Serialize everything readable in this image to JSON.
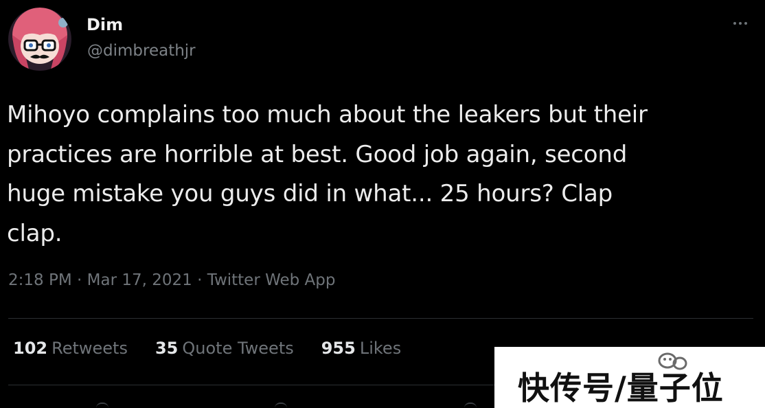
{
  "tweet": {
    "author": {
      "name": "Dim",
      "handle": "@dimbreathjr"
    },
    "text_lines": [
      "Mihoyo complains too much about the leakers but their",
      "practices are horrible at best. Good job again, second",
      "huge mistake you guys did in what... 25 hours? Clap",
      "clap."
    ],
    "meta": {
      "time": "2:18 PM",
      "separator": " · ",
      "date": "Mar 17, 2021",
      "source": "Twitter Web App"
    },
    "stats": {
      "retweets": {
        "count": "102",
        "label": "Retweets"
      },
      "quote_tweets": {
        "count": "35",
        "label": "Quote Tweets"
      },
      "likes": {
        "count": "955",
        "label": "Likes"
      }
    },
    "more_icon": "more-dots-icon"
  },
  "watermark": {
    "text": "快传号/量子位"
  },
  "colors": {
    "background": "#000000",
    "text": "#ececec",
    "muted": "#6f7479",
    "divider": "#2c2f33"
  }
}
